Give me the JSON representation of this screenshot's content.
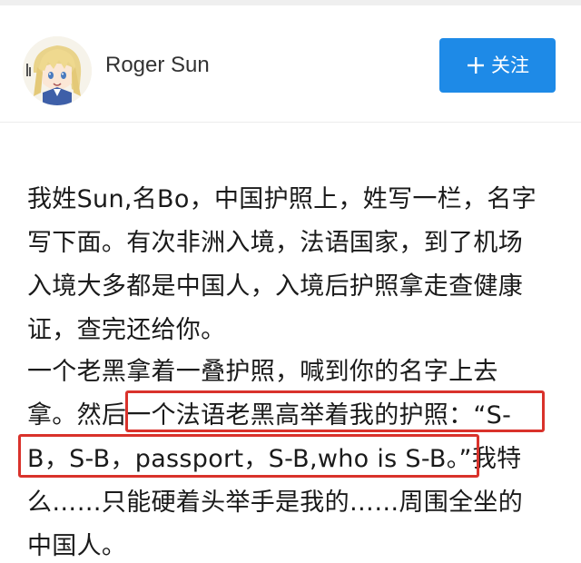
{
  "author": {
    "name": "Roger Sun",
    "avatar_icon": "anime-girl-avatar"
  },
  "follow_button": {
    "icon": "plus-icon",
    "label": "关注",
    "color": "#1e8ae7"
  },
  "article": {
    "lines": [
      "我姓Sun,名Bo，中国护照上，姓写一栏，名字",
      "写下面。有次非洲入境，法语国家，到了机场",
      "入境大多都是中国人，入境后护照拿走查健康",
      "证，查完还给你。",
      "一个老黑拿着一叠护照，喊到你的名字上去",
      "拿。然后一个法语老黑高举着我的护照：“S-",
      "B，S-B，passport，S-B,who is S-B。”我特",
      "么……只能硬着头举手是我的……周围全坐的",
      "中国人。"
    ],
    "highlight_color": "#d9322b"
  }
}
